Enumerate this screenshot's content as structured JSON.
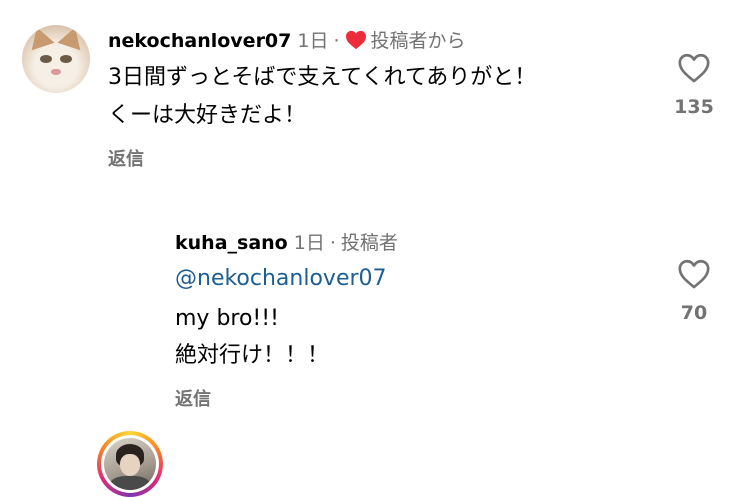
{
  "comments": [
    {
      "username": "nekochanlover07",
      "time": "1日",
      "separator": "·",
      "badge_text": "投稿者から",
      "lines": [
        "3日間ずっとそばで支えてくれてありがと！",
        "くーは大好きだよ！"
      ],
      "reply_label": "返信",
      "like_count": "135",
      "liked_by_author": true,
      "avatar_icon": "cat-avatar"
    },
    {
      "username": "kuha_sano",
      "time": "1日",
      "separator": "·",
      "badge_text": "投稿者",
      "mention": "@nekochanlover07",
      "lines": [
        "my bro!!!",
        "絶対行け！！！"
      ],
      "reply_label": "返信",
      "like_count": "70",
      "avatar_icon": "person-avatar-story-ring"
    }
  ],
  "colors": {
    "heart_red": "#ed2b3a",
    "meta_gray": "#737373",
    "mention_blue": "#1d5e91"
  }
}
